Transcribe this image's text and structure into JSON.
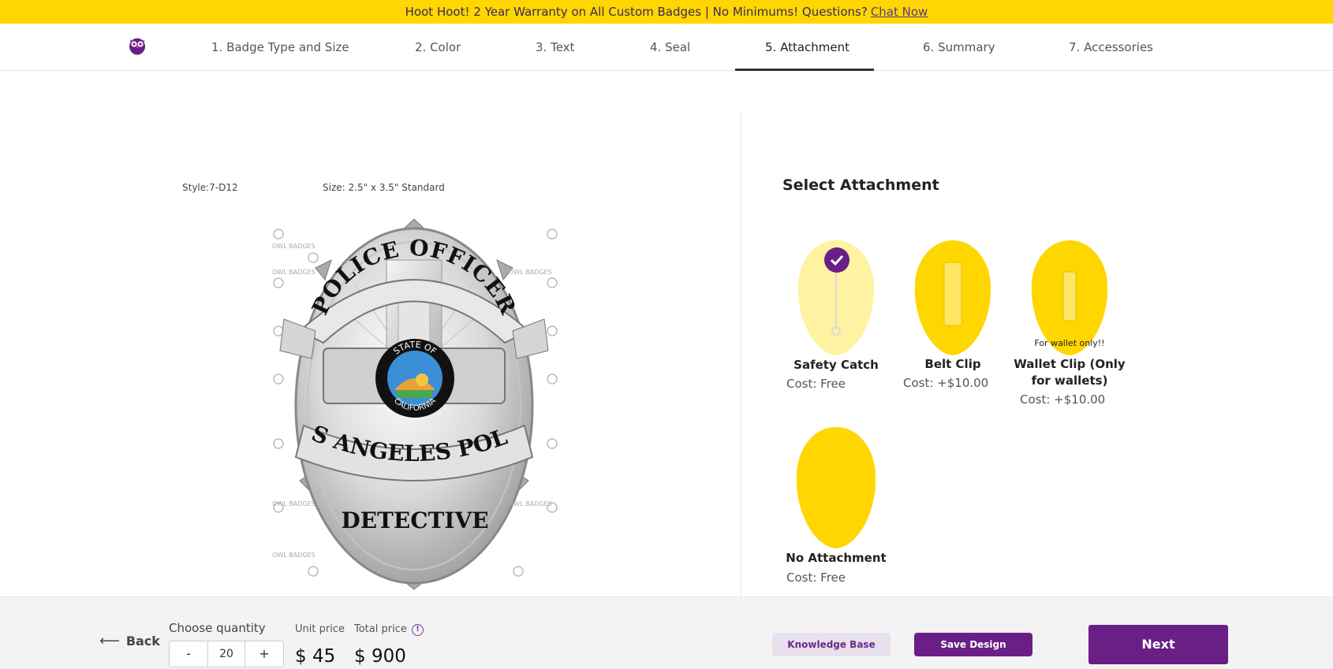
{
  "banner": {
    "text": "Hoot Hoot! 2 Year Warranty on All Custom Badges | No Minimums!  Questions?",
    "chat_link": "Chat Now"
  },
  "nav": {
    "steps": [
      {
        "label": "1. Badge Type and Size"
      },
      {
        "label": "2. Color"
      },
      {
        "label": "3. Text"
      },
      {
        "label": "4. Seal"
      },
      {
        "label": "5. Attachment",
        "active": true
      },
      {
        "label": "6. Summary"
      },
      {
        "label": "7. Accessories"
      }
    ]
  },
  "badge": {
    "style": "Style:7-D12",
    "size": "Size: 2.5\" x 3.5\" Standard",
    "top_text": "POLICE OFFICER",
    "middle_text": "LOS ANGELES POLICE",
    "bottom_text": "DETECTIVE",
    "seal_top": "STATE OF",
    "seal_bottom": "CALIFORNIA",
    "watermark": "OWL BADGES"
  },
  "attachment": {
    "title": "Select Attachment",
    "options": [
      {
        "name": "Safety Catch",
        "cost": "Cost: Free",
        "selected": true
      },
      {
        "name": "Belt Clip",
        "cost": "Cost: +$10.00"
      },
      {
        "name": "Wallet Clip (Only for wallets)",
        "cost": "Cost: +$10.00",
        "note": "For wallet only!!"
      },
      {
        "name": "No Attachment",
        "cost": "Cost: Free"
      }
    ]
  },
  "footer": {
    "back": "Back",
    "choose_quantity": "Choose quantity",
    "quantity": "20",
    "minus": "-",
    "plus": "+",
    "unit_price_label": "Unit price",
    "unit_price": "$ 45",
    "total_price_label": "Total price",
    "total_price": "$ 900",
    "knowledge_base": "Knowledge Base",
    "save_design": "Save Design",
    "next": "Next"
  },
  "colors": {
    "banner": "#ffd600",
    "accent": "#6a1f87",
    "badge_yellow": "#ffd600",
    "badge_pale": "#fff2a0"
  }
}
